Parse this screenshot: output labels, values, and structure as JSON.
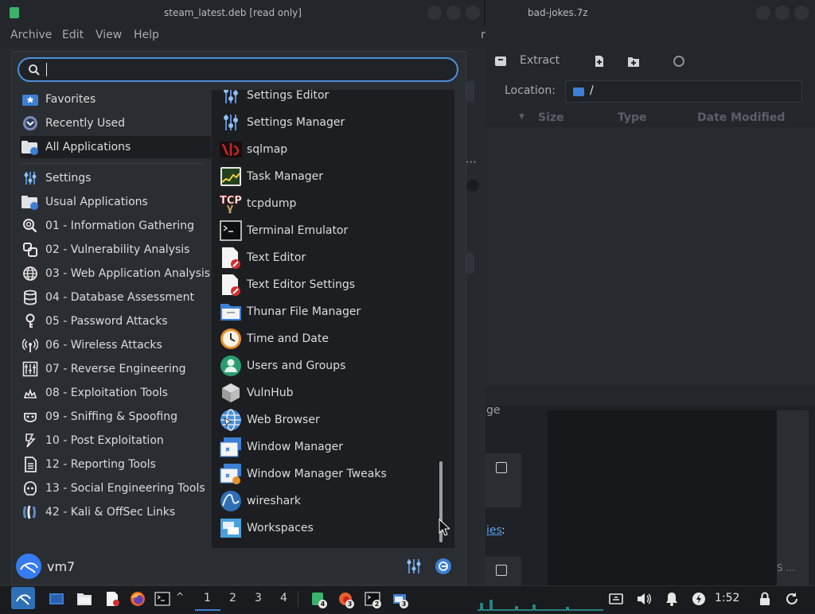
{
  "bg_window_left": {
    "title": "steam_latest.deb [read only]",
    "menubar": [
      "Archive",
      "Edit",
      "View",
      "Help"
    ],
    "partial_char": "n"
  },
  "bg_window_right": {
    "title": "bad-jokes.7z",
    "toolbar": {
      "extract_label": "Extract"
    },
    "location_label": "Location:",
    "location_value": "/",
    "columns": [
      "Size",
      "Type",
      "Date Modified"
    ]
  },
  "bg_doc": {
    "link_fragment": "ies",
    "colon": ":",
    "fragment_ge": "ge",
    "fragment_s": "S ..."
  },
  "menu": {
    "search": {
      "value": "",
      "placeholder": ""
    },
    "categories": [
      {
        "label": "Favorites",
        "icon": "star-icon"
      },
      {
        "label": "Recently Used",
        "icon": "clock-icon"
      },
      {
        "label": "All Applications",
        "icon": "folder-apps-icon",
        "selected": true
      },
      {
        "label": "Settings",
        "icon": "settings-icon"
      },
      {
        "label": "Usual Applications",
        "icon": "folder-apps-icon"
      },
      {
        "label": "01 - Information Gathering",
        "icon": "magnifier-icon"
      },
      {
        "label": "02 - Vulnerability Analysis",
        "icon": "vuln-icon"
      },
      {
        "label": "03 - Web Application Analysis",
        "icon": "globe-icon"
      },
      {
        "label": "04 - Database Assessment",
        "icon": "database-icon"
      },
      {
        "label": "05 - Password Attacks",
        "icon": "key-icon"
      },
      {
        "label": "06 - Wireless Attacks",
        "icon": "wireless-icon"
      },
      {
        "label": "07 - Reverse Engineering",
        "icon": "reverse-icon"
      },
      {
        "label": "08 - Exploitation Tools",
        "icon": "exploit-icon"
      },
      {
        "label": "09 - Sniffing & Spoofing",
        "icon": "sniff-icon"
      },
      {
        "label": "10 - Post Exploitation",
        "icon": "post-exploit-icon"
      },
      {
        "label": "12 - Reporting Tools",
        "icon": "report-icon"
      },
      {
        "label": "13 - Social Engineering Tools",
        "icon": "social-icon"
      },
      {
        "label": "42 - Kali & OffSec Links",
        "icon": "kali-icon"
      }
    ],
    "apps": [
      {
        "label": "Settings Editor",
        "icon": "settings-editor-icon"
      },
      {
        "label": "Settings Manager",
        "icon": "settings-manager-icon"
      },
      {
        "label": "sqlmap",
        "icon": "sqlmap-icon"
      },
      {
        "label": "Task Manager",
        "icon": "task-manager-icon"
      },
      {
        "label": "tcpdump",
        "icon": "tcpdump-icon"
      },
      {
        "label": "Terminal Emulator",
        "icon": "terminal-icon"
      },
      {
        "label": "Text Editor",
        "icon": "text-editor-icon"
      },
      {
        "label": "Text Editor Settings",
        "icon": "text-editor-settings-icon"
      },
      {
        "label": "Thunar File Manager",
        "icon": "file-manager-icon"
      },
      {
        "label": "Time and Date",
        "icon": "clock-icon"
      },
      {
        "label": "Users and Groups",
        "icon": "users-icon"
      },
      {
        "label": "VulnHub",
        "icon": "vulnhub-icon"
      },
      {
        "label": "Web Browser",
        "icon": "web-browser-icon"
      },
      {
        "label": "Window Manager",
        "icon": "window-manager-icon"
      },
      {
        "label": "Window Manager Tweaks",
        "icon": "window-manager-tweaks-icon"
      },
      {
        "label": "wireshark",
        "icon": "wireshark-icon"
      },
      {
        "label": "Workspaces",
        "icon": "workspaces-icon"
      }
    ],
    "user": {
      "name": "vm7"
    }
  },
  "panel": {
    "workspaces": [
      "1",
      "2",
      "3",
      "4"
    ],
    "task_badges": [
      "4",
      "3",
      "2",
      "3"
    ],
    "clock": "1:52"
  },
  "colors": {
    "accent": "#4e8fd9",
    "menu_bg": "#2a2d32",
    "list_bg": "#1c1e22",
    "panel_bg": "#191b1f"
  }
}
